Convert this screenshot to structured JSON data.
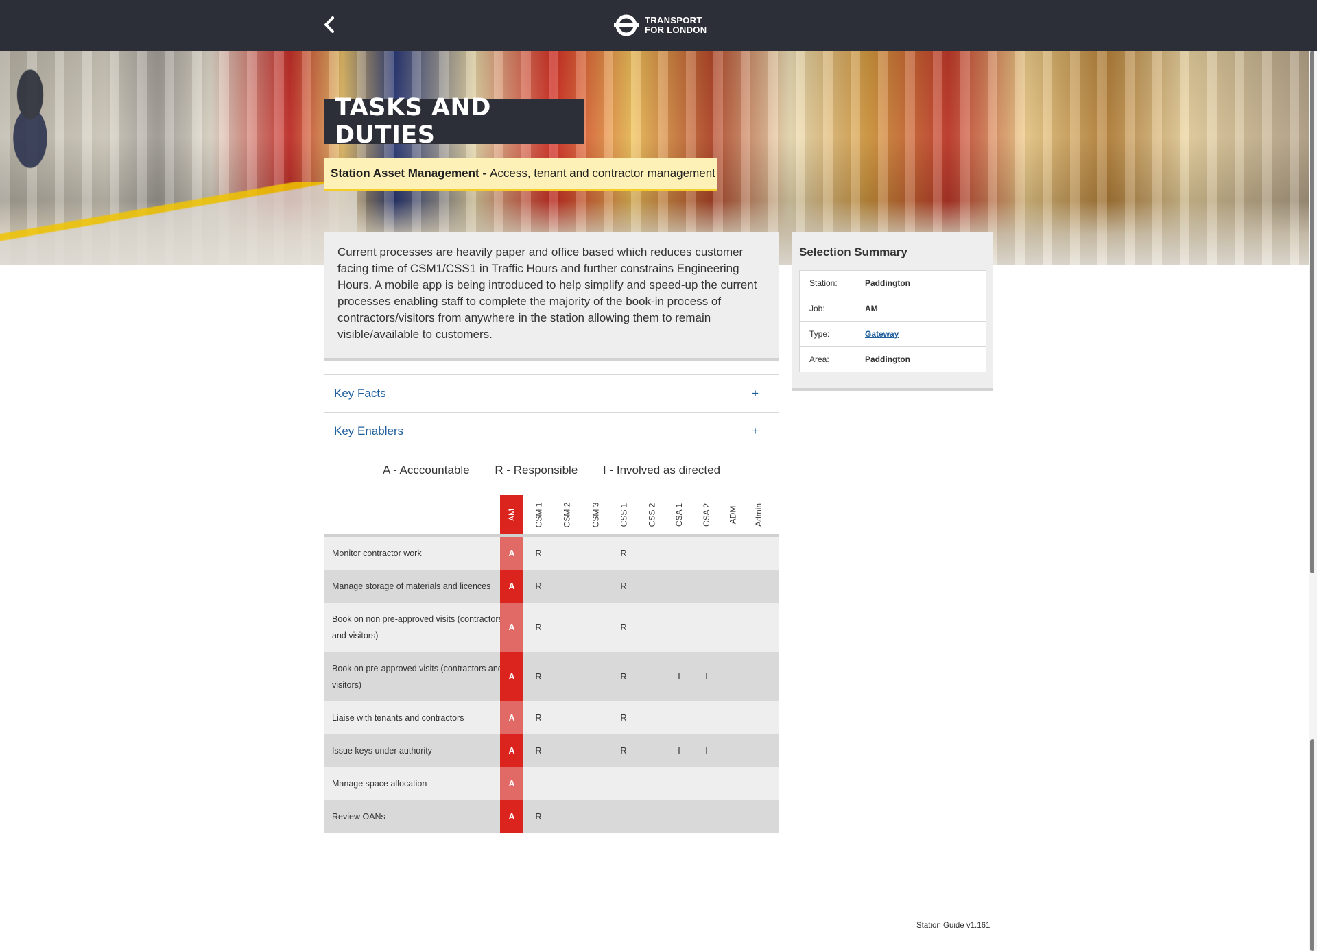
{
  "header": {
    "back_label": "Back",
    "logo_line1": "TRANSPORT",
    "logo_line2": "FOR LONDON"
  },
  "hero": {
    "title": "TASKS AND DUTIES",
    "subtitle_bold": "Station Asset Management -",
    "subtitle_rest": "Access, tenant and contractor management"
  },
  "description": "Current processes are heavily paper and office based which reduces customer facing time of CSM1/CSS1 in Traffic Hours and further constrains Engineering Hours. A mobile app is being introduced to help simplify and speed-up the current processes enabling staff to complete the majority of the book-in process of contractors/visitors from anywhere in the station allowing them to remain visible/available to customers.",
  "accordion": [
    {
      "label": "Key Facts",
      "icon": "+"
    },
    {
      "label": "Key Enablers",
      "icon": "+"
    }
  ],
  "legend": {
    "a": "A - Acccountable",
    "r": "R - Responsible",
    "i": "I - Involved as directed"
  },
  "matrix": {
    "columns": [
      "AM",
      "CSM 1",
      "CSM 2",
      "CSM 3",
      "CSS 1",
      "CSS 2",
      "CSA 1",
      "CSA 2",
      "ADM",
      "Admin"
    ],
    "rows": [
      {
        "task": "Monitor contractor work",
        "values": [
          "A",
          "R",
          "",
          "",
          "R",
          "",
          "",
          "",
          "",
          ""
        ]
      },
      {
        "task": "Manage storage of materials and licences",
        "values": [
          "A",
          "R",
          "",
          "",
          "R",
          "",
          "",
          "",
          "",
          ""
        ]
      },
      {
        "task": "Book on non pre-approved visits (contractors and visitors)",
        "values": [
          "A",
          "R",
          "",
          "",
          "R",
          "",
          "",
          "",
          "",
          ""
        ]
      },
      {
        "task": "Book on pre-approved visits (contractors and visitors)",
        "values": [
          "A",
          "R",
          "",
          "",
          "R",
          "",
          "I",
          "I",
          "",
          ""
        ]
      },
      {
        "task": "Liaise with tenants and contractors",
        "values": [
          "A",
          "R",
          "",
          "",
          "R",
          "",
          "",
          "",
          "",
          ""
        ]
      },
      {
        "task": "Issue keys under authority",
        "values": [
          "A",
          "R",
          "",
          "",
          "R",
          "",
          "I",
          "I",
          "",
          ""
        ]
      },
      {
        "task": "Manage space allocation",
        "values": [
          "A",
          "",
          "",
          "",
          "",
          "",
          "",
          "",
          "",
          ""
        ]
      },
      {
        "task": "Review OANs",
        "values": [
          "A",
          "R",
          "",
          "",
          "",
          "",
          "",
          "",
          "",
          ""
        ]
      }
    ],
    "colors": {
      "am_header": "#dc241f",
      "row_light": "#eeeeee",
      "row_dark": "#d9d9d9",
      "am_cell_a": "#e26a66",
      "am_cell_b": "#dc241f"
    }
  },
  "summary": {
    "title": "Selection Summary",
    "items": [
      {
        "key": "Station:",
        "value": "Paddington"
      },
      {
        "key": "Job:",
        "value": "AM"
      },
      {
        "key": "Type:",
        "value": "Gateway"
      },
      {
        "key": "Area:",
        "value": "Paddington"
      }
    ]
  },
  "footer": {
    "version": "Station Guide v1.161"
  }
}
